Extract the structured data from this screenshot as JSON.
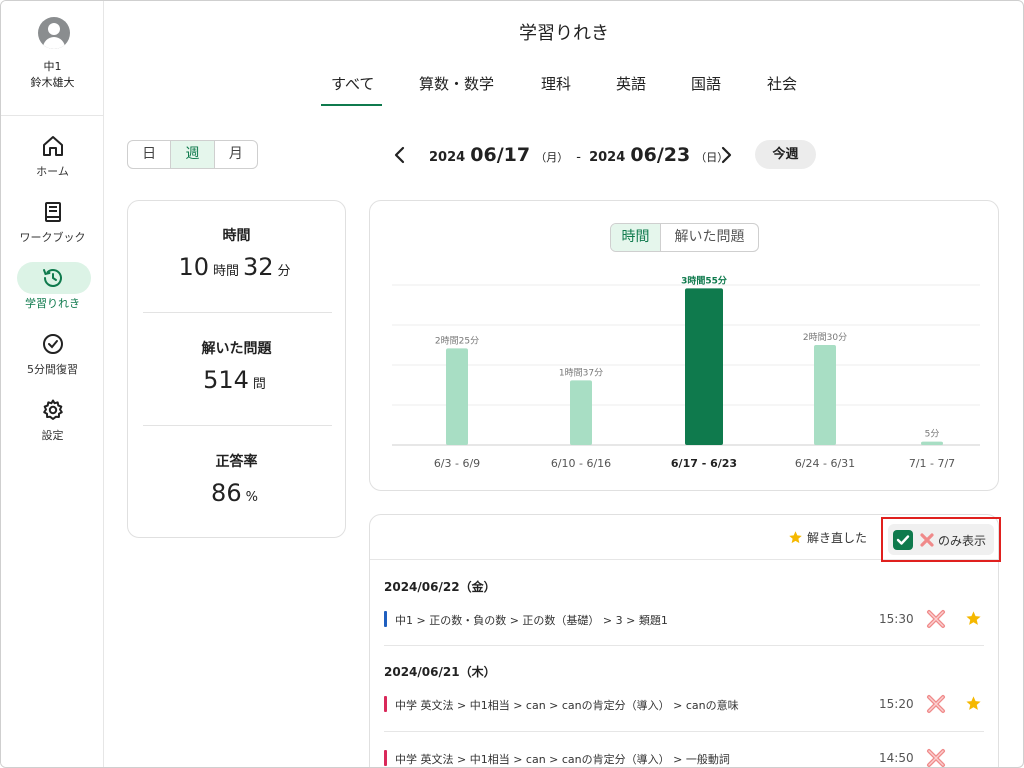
{
  "sidebar": {
    "grade": "中1",
    "user_name": "鈴木雄大",
    "items": [
      {
        "label": "ホーム",
        "icon": "home-icon"
      },
      {
        "label": "ワークブック",
        "icon": "book-icon"
      },
      {
        "label": "学習りれき",
        "icon": "history-icon",
        "active": true
      },
      {
        "label": "5分間復習",
        "icon": "check-circle-icon"
      },
      {
        "label": "設定",
        "icon": "gear-icon"
      }
    ]
  },
  "header": {
    "title": "学習りれき",
    "tabs": [
      "すべて",
      "算数・数学",
      "理科",
      "英語",
      "国語",
      "社会"
    ],
    "active_tab": "すべて"
  },
  "period": {
    "options": [
      "日",
      "週",
      "月"
    ],
    "selected": "週"
  },
  "range": {
    "start_year": "2024",
    "start_md": "06/17",
    "start_dow": "（月）",
    "dash": "-",
    "end_year": "2024",
    "end_md": "06/23",
    "end_dow": "（日）",
    "this_week": "今週"
  },
  "stats": {
    "time_label": "時間",
    "time_hours": "10",
    "time_hours_unit": "時間",
    "time_minutes": "32",
    "time_minutes_unit": "分",
    "solved_label": "解いた問題",
    "solved_value": "514",
    "solved_unit": "問",
    "accuracy_label": "正答率",
    "accuracy_value": "86",
    "accuracy_unit": "%"
  },
  "chart_toggle": {
    "time": "時間",
    "solved": "解いた問題",
    "selected": "時間"
  },
  "chart_data": {
    "type": "bar",
    "categories": [
      "6/3 - 6/9",
      "6/10 - 6/16",
      "6/17 - 6/23",
      "6/24 - 6/31",
      "7/1 - 7/7"
    ],
    "values": [
      145,
      97,
      235,
      150,
      5
    ],
    "value_labels": [
      "2時間25分",
      "1時間37分",
      "3時間55分",
      "2時間30分",
      "5分"
    ],
    "highlight_index": 2,
    "ylim": [
      0,
      240
    ],
    "grid": true,
    "colors": {
      "normal": "#a8dec4",
      "highlight": "#0f7a4d"
    }
  },
  "history": {
    "resolved_label": "解き直した",
    "filter_label": "のみ表示",
    "groups": [
      {
        "date": "2024/06/22（金）",
        "rows": [
          {
            "path": "中1 > 正の数・負の数 > 正の数（基礎） > 3 > 類題1",
            "time": "15:30",
            "color": "#1f5fbf",
            "star": true
          }
        ]
      },
      {
        "date": "2024/06/21（木）",
        "rows": [
          {
            "path": "中学 英文法 > 中1相当 > can > canの肯定分（導入） > canの意味",
            "time": "15:20",
            "color": "#d9295a",
            "star": true
          },
          {
            "path": "中学 英文法 > 中1相当 > can > canの肯定分（導入） > 一般動詞",
            "time": "14:50",
            "color": "#d9295a",
            "star": false
          }
        ]
      }
    ]
  },
  "colors": {
    "accent": "#0f7a4d",
    "accent_light": "#dcf3e6",
    "incorrect": "#f08a8a",
    "star": "#f5b800",
    "highlight_box": "#e0201e"
  }
}
